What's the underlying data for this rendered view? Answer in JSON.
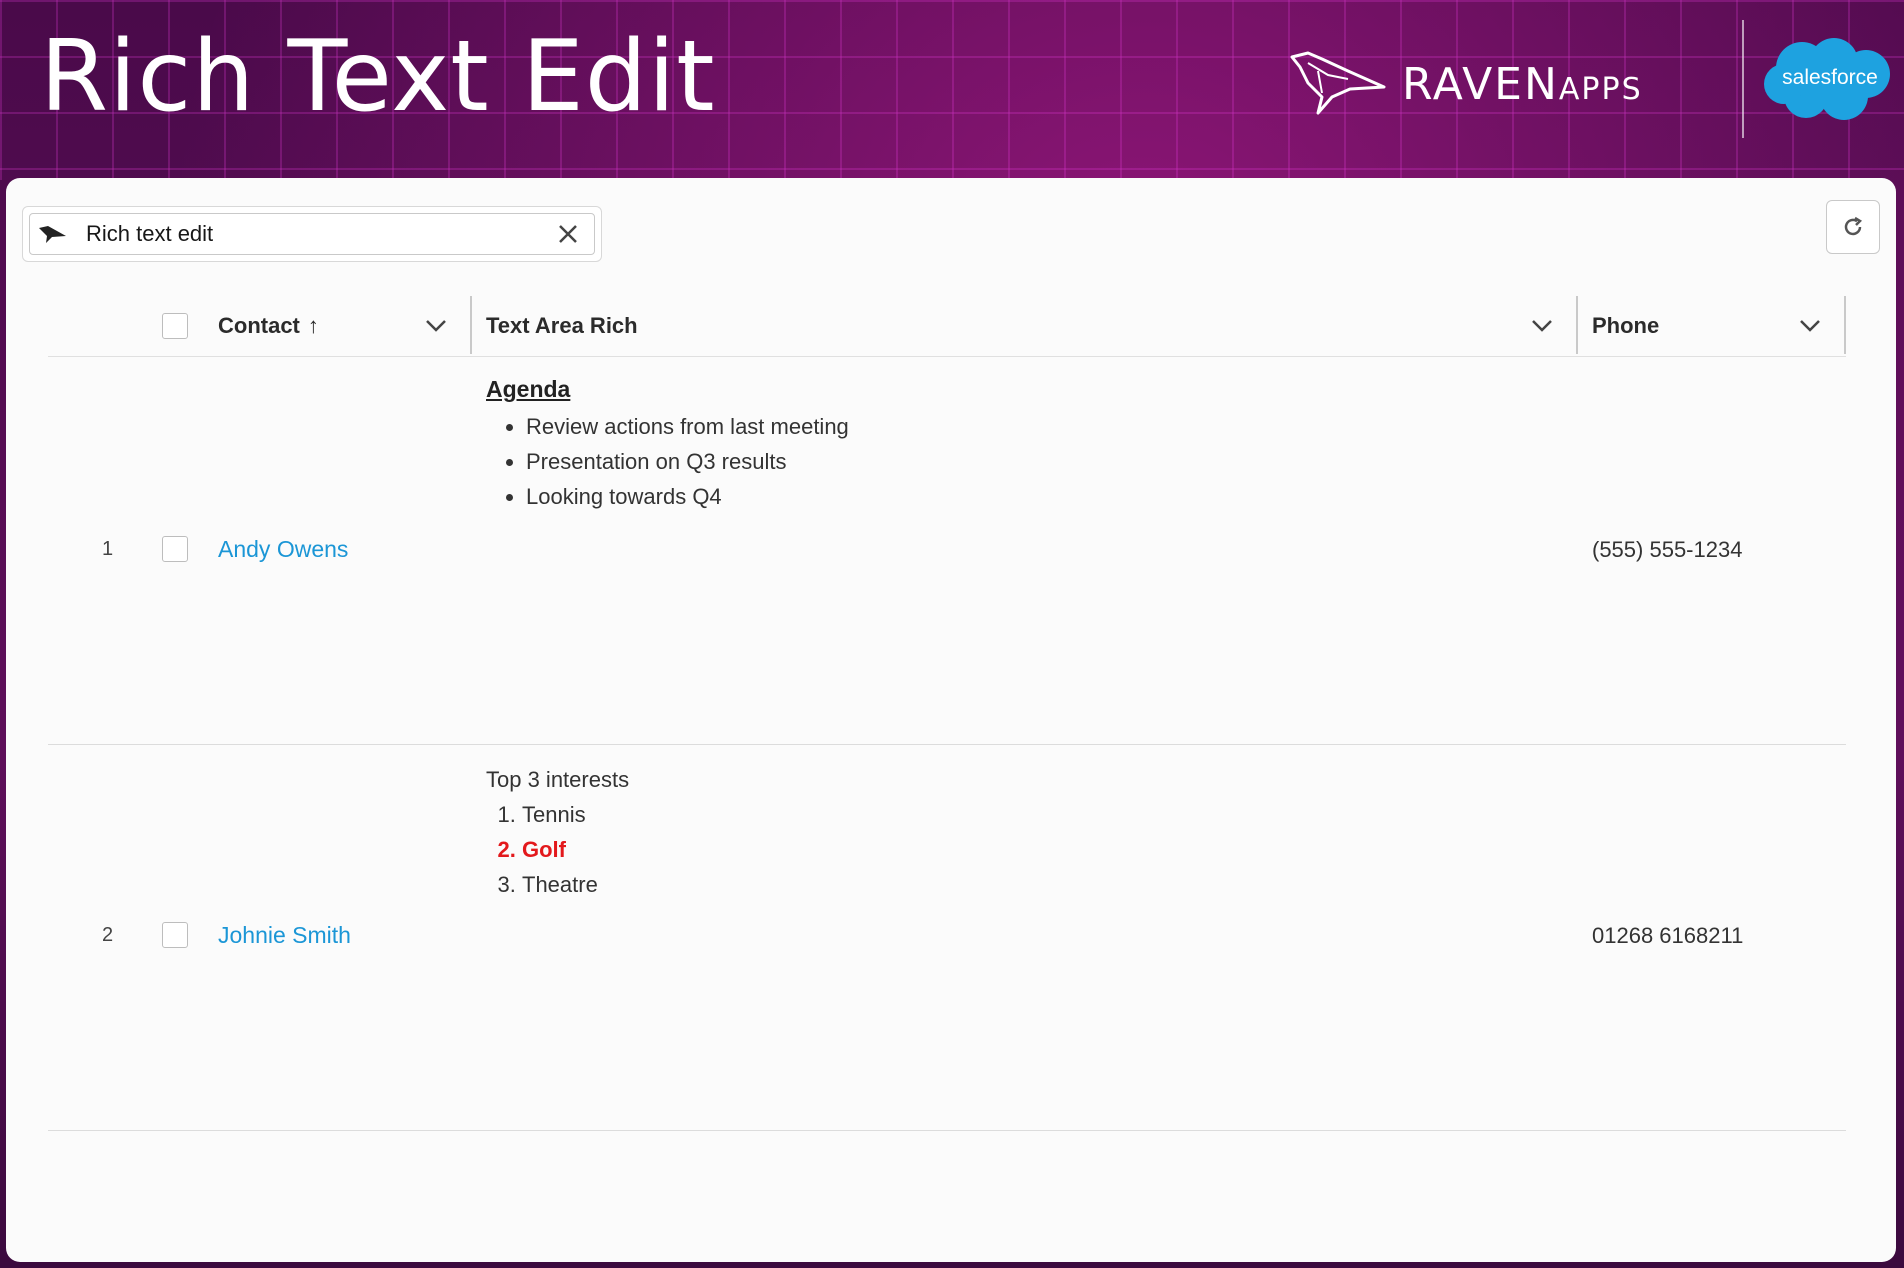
{
  "banner": {
    "title": "Rich Text Edit",
    "brand_main": "RAVEN",
    "brand_sub": "APPS",
    "partner_logo_text": "salesforce"
  },
  "search": {
    "value": "Rich text edit"
  },
  "table": {
    "columns": [
      {
        "label": "Contact",
        "sort_indicator": "↑"
      },
      {
        "label": "Text Area Rich"
      },
      {
        "label": "Phone"
      }
    ],
    "rows": [
      {
        "number": "1",
        "contact": "Andy Owens",
        "phone": "(555) 555-1234",
        "rich": {
          "heading": "Agenda",
          "bullets": [
            "Review actions from last meeting",
            "Presentation on Q3 results",
            "Looking towards Q4"
          ]
        }
      },
      {
        "number": "2",
        "contact": "Johnie Smith",
        "phone": "01268 6168211",
        "rich": {
          "intro": "Top 3 interests",
          "ordered": [
            "Tennis",
            "Golf",
            "Theatre"
          ]
        }
      }
    ]
  },
  "colors": {
    "link": "#1b96d6",
    "highlight": "#e3191c"
  },
  "icons": [
    "raven-icon",
    "close-icon",
    "refresh-icon",
    "chevron-down-icon"
  ]
}
